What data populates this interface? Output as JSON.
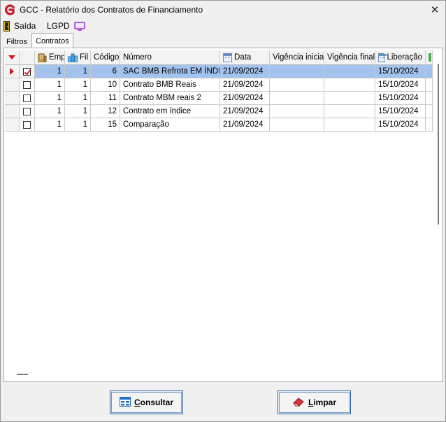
{
  "window": {
    "title": "GCC - Relatório dos Contratos de Financiamento",
    "close_symbol": "✕"
  },
  "menu": {
    "saida_label": "Saída",
    "lgpd_label": "LGPD"
  },
  "tabs": {
    "filtros": "Filtros",
    "contratos": "Contratos"
  },
  "grid": {
    "columns": {
      "emp": "Emp",
      "fil": "Fil",
      "codigo": "Código",
      "numero": "Número",
      "data": "Data",
      "vigencia_inicial": "Vigência inicial",
      "vigencia_final": "Vigência final",
      "liberacao": "Liberação"
    },
    "rows": [
      {
        "checked": true,
        "emp": "1",
        "fil": "1",
        "codigo": "6",
        "numero": "SAC BMB Refrota EM ÍNDI...",
        "data": "21/09/2024",
        "vigencia_inicial": "",
        "vigencia_final": "",
        "liberacao": "15/10/2024"
      },
      {
        "checked": false,
        "emp": "1",
        "fil": "1",
        "codigo": "10",
        "numero": "Contrato BMB Reais",
        "data": "21/09/2024",
        "vigencia_inicial": "",
        "vigencia_final": "",
        "liberacao": "15/10/2024"
      },
      {
        "checked": false,
        "emp": "1",
        "fil": "1",
        "codigo": "11",
        "numero": "Contrato MBM reais 2",
        "data": "21/09/2024",
        "vigencia_inicial": "",
        "vigencia_final": "",
        "liberacao": "15/10/2024"
      },
      {
        "checked": false,
        "emp": "1",
        "fil": "1",
        "codigo": "12",
        "numero": "Contrato em índice",
        "data": "21/09/2024",
        "vigencia_inicial": "",
        "vigencia_final": "",
        "liberacao": "15/10/2024"
      },
      {
        "checked": false,
        "emp": "1",
        "fil": "1",
        "codigo": "15",
        "numero": "Comparação",
        "data": "21/09/2024",
        "vigencia_inicial": "",
        "vigencia_final": "",
        "liberacao": "15/10/2024"
      }
    ]
  },
  "buttons": {
    "consultar": {
      "mnemonic": "C",
      "rest": "onsultar"
    },
    "limpar": {
      "mnemonic": "L",
      "rest": "impar"
    }
  },
  "colors": {
    "accent_red": "#cc1a1a",
    "selection": "#a4c2ee",
    "button_border": "#1e5fa8"
  }
}
